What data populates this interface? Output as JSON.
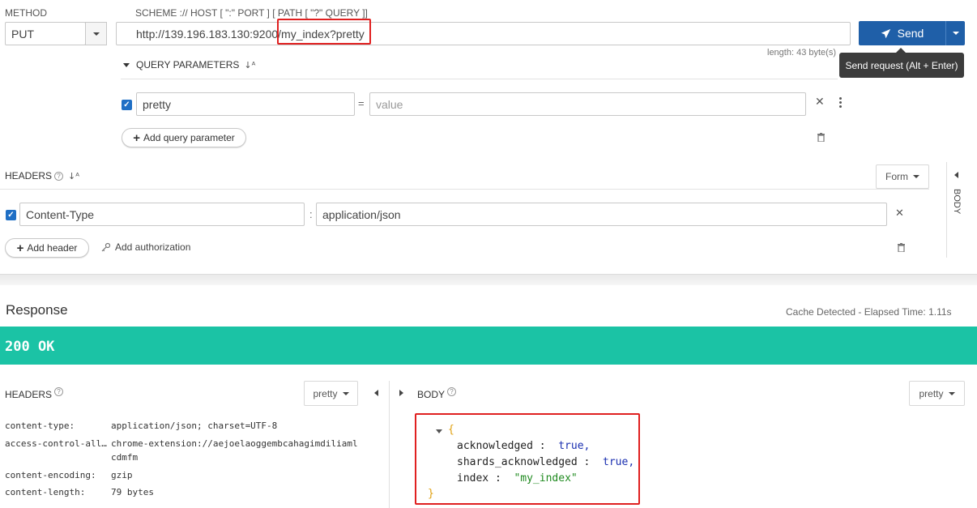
{
  "request": {
    "method_label": "METHOD",
    "method_value": "PUT",
    "url_label": "SCHEME :// HOST [ \":\" PORT ] [ PATH [ \"?\" QUERY ]]",
    "url_base": "http://139.196.183.130:9200/",
    "url_path": "my_index?pretty",
    "send_label": "Send",
    "tooltip": "Send request (Alt + Enter)",
    "length_text": "length: 43 byte(s)"
  },
  "query": {
    "section_label": "QUERY PARAMETERS",
    "param_name": "pretty",
    "equals": "=",
    "value_placeholder": "value",
    "add_label": "Add query parameter"
  },
  "headers": {
    "section_label": "HEADERS",
    "form_label": "Form",
    "body_tab": "BODY",
    "header_name": "Content-Type",
    "colon": ":",
    "header_value": "application/json",
    "add_header_label": "Add header",
    "add_auth_label": "Add authorization"
  },
  "response": {
    "title": "Response",
    "cache_text": "Cache Detected - Elapsed Time: 1.11s",
    "status": "200 OK",
    "status_color": "#1bc3a5",
    "headers_label": "HEADERS",
    "body_label": "BODY",
    "headers_format": "pretty",
    "body_format": "pretty",
    "header_rows": [
      {
        "key": "content-type:",
        "value": "application/json; charset=UTF-8"
      },
      {
        "key": "access-control-all…",
        "value": "chrome-extension://aejoelaoggembcahagimdiliaml"
      },
      {
        "key": "",
        "value": "cdmfm"
      },
      {
        "key": "content-encoding:",
        "value": "gzip"
      },
      {
        "key": "content-length:",
        "value": "79 bytes"
      }
    ],
    "json": {
      "open": "{",
      "close": "}",
      "lines": [
        {
          "key": "acknowledged",
          "value": "true,"
        },
        {
          "key": "shards_acknowledged",
          "value": "true,"
        },
        {
          "key": "index",
          "value": "\"my_index\""
        }
      ]
    }
  },
  "icons": {
    "send": "paper-plane-icon",
    "sort": "sort-az-icon",
    "help": "question-circle-icon",
    "trash": "trash-icon",
    "close": "close-icon",
    "more": "more-vertical-icon",
    "key": "key-icon"
  }
}
